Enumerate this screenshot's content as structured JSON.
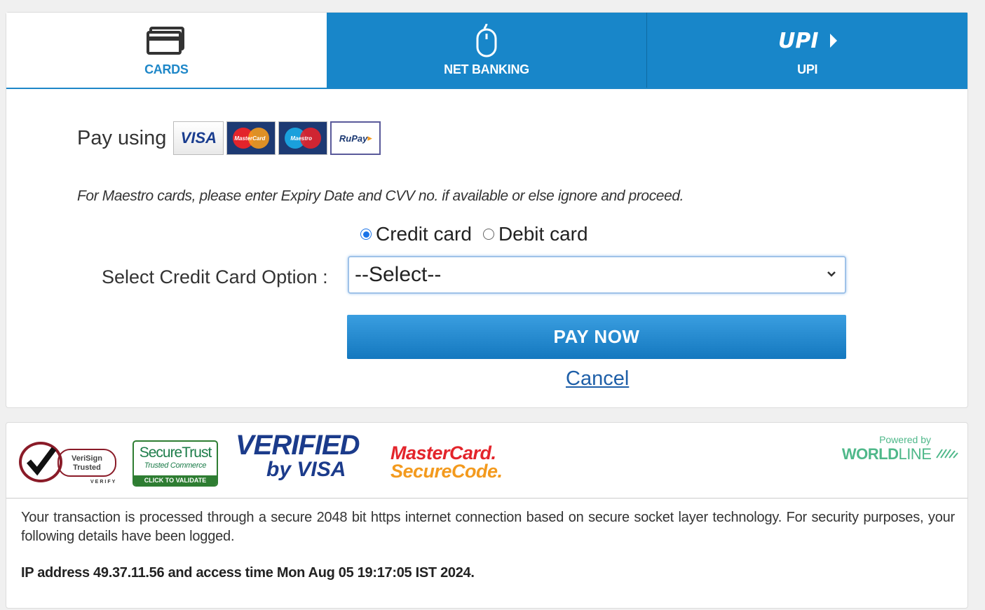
{
  "tabs": [
    {
      "label": "CARDS",
      "icon": "card-icon",
      "active": true
    },
    {
      "label": "NET BANKING",
      "icon": "mouse-icon",
      "active": false
    },
    {
      "label": "UPI",
      "icon": "upi-logo-icon",
      "active": false
    }
  ],
  "upi_logo_text": "UPI",
  "pay_using": {
    "label": "Pay using",
    "logos": {
      "visa": "VISA",
      "mastercard": "MasterCard",
      "maestro": "Maestro",
      "rupay": "RuPay"
    }
  },
  "maestro_note": "For Maestro cards, please enter Expiry Date and CVV no. if available or else ignore and proceed.",
  "card_type": {
    "options": [
      "Credit card",
      "Debit card"
    ],
    "selected": "Credit card"
  },
  "select": {
    "label": "Select Credit Card Option :",
    "value": "--Select--"
  },
  "pay_button": "PAY NOW",
  "cancel_link": "Cancel",
  "badges": {
    "verisign": {
      "line1": "VeriSign",
      "line2": "Trusted",
      "sub": "VERIFY"
    },
    "securetrust": {
      "title": "SecureTrust",
      "sub": "Trusted Commerce",
      "cta": "CLICK TO VALIDATE"
    },
    "vbv": {
      "line1": "VERIFIED",
      "line2": "by VISA"
    },
    "mcsc": {
      "line1": "MasterCard.",
      "line2": "SecureCode."
    },
    "worldline": {
      "powered": "Powered by",
      "name_bold": "WORLD",
      "name_thin": "LINE"
    }
  },
  "secure_text": "Your transaction is processed through a secure 2048 bit https internet connection based on secure socket layer technology. For security purposes, your following details have been logged.",
  "ip_text": "IP address 49.37.11.56 and access time Mon Aug 05 19:17:05 IST 2024.",
  "colors": {
    "accent": "#1886c9",
    "worldline": "#4fb88a"
  }
}
